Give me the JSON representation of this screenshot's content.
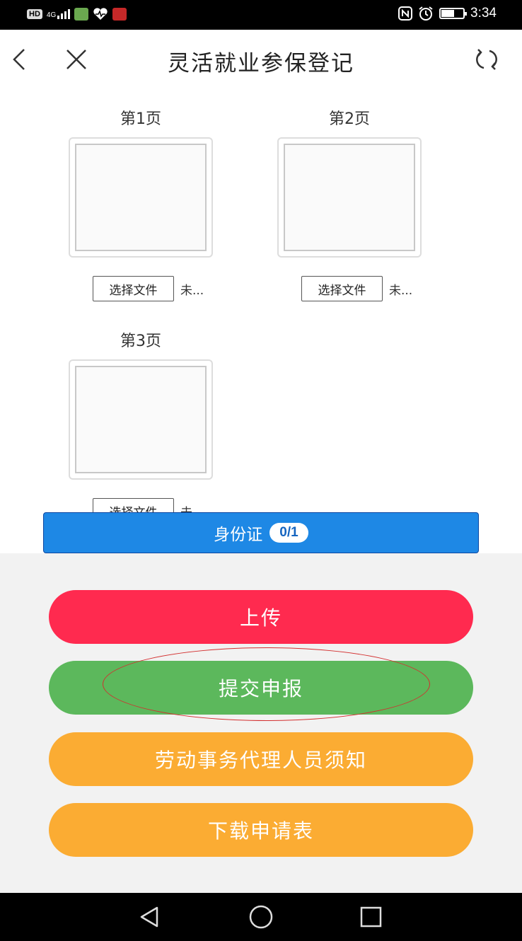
{
  "status_bar": {
    "hd_badge": "HD",
    "network": "4G",
    "time": "3:34",
    "battery_level": 0.55
  },
  "header": {
    "title": "灵活就业参保登记",
    "back_icon": "chevron-left-icon",
    "close_icon": "close-icon",
    "refresh_icon": "refresh-icon"
  },
  "pages": [
    {
      "label": "第1页",
      "file_button": "选择文件",
      "file_status": "未..."
    },
    {
      "label": "第2页",
      "file_button": "选择文件",
      "file_status": "未..."
    },
    {
      "label": "第3页",
      "file_button": "选择文件",
      "file_status": "未..."
    }
  ],
  "id_card": {
    "label": "身份证",
    "count": "0/1"
  },
  "actions": {
    "upload": "上传",
    "submit": "提交申报",
    "notice": "劳动事务代理人员须知",
    "download": "下载申请表"
  },
  "colors": {
    "upload": "#ff2a4f",
    "submit": "#5cb85c",
    "notice": "#fbac33",
    "download": "#fbac33",
    "id_bar": "#1e88e5"
  }
}
